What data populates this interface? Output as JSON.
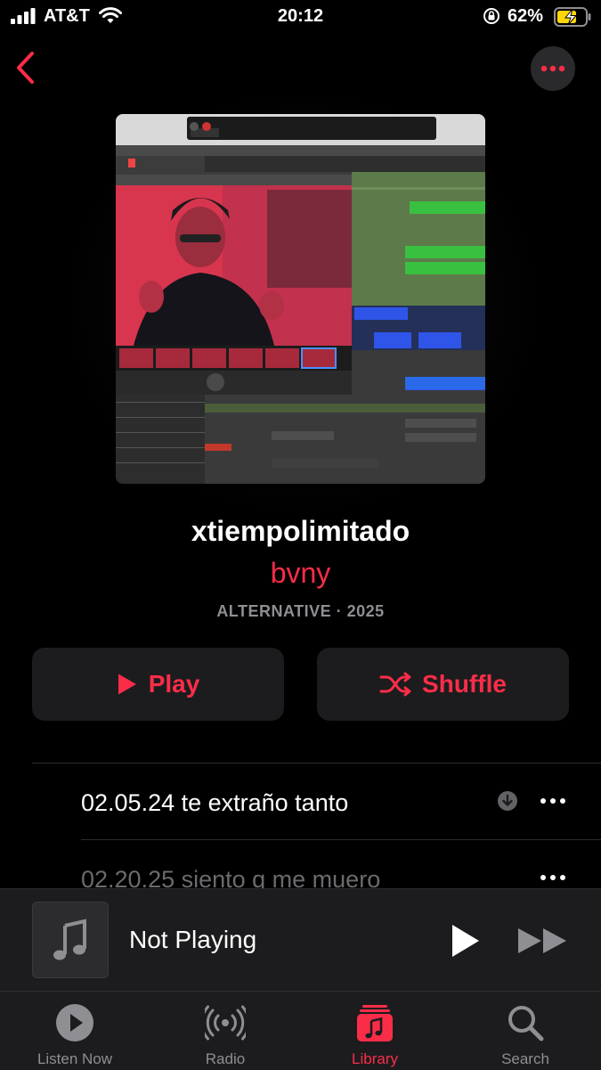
{
  "status": {
    "carrier": "AT&T",
    "time": "20:12",
    "battery_percent": "62%"
  },
  "album": {
    "title": "xtiempolimitado",
    "artist": "bvny",
    "meta": "ALTERNATIVE · 2025"
  },
  "actions": {
    "play_label": "Play",
    "shuffle_label": "Shuffle"
  },
  "tracks": [
    {
      "title": "02.05.24 te extraño tanto",
      "downloaded": true
    },
    {
      "title": "02.20.25 siento q me muero"
    }
  ],
  "mini_player": {
    "title": "Not Playing"
  },
  "tabs": [
    {
      "label": "Listen Now",
      "icon": "play-circle-icon"
    },
    {
      "label": "Radio",
      "icon": "radio-waves-icon"
    },
    {
      "label": "Library",
      "icon": "library-icon",
      "active": true
    },
    {
      "label": "Search",
      "icon": "search-icon"
    }
  ],
  "colors": {
    "accent": "#fa2d48",
    "background": "#000000",
    "surface": "#1c1c1e",
    "secondary_text": "#8e8e93"
  }
}
